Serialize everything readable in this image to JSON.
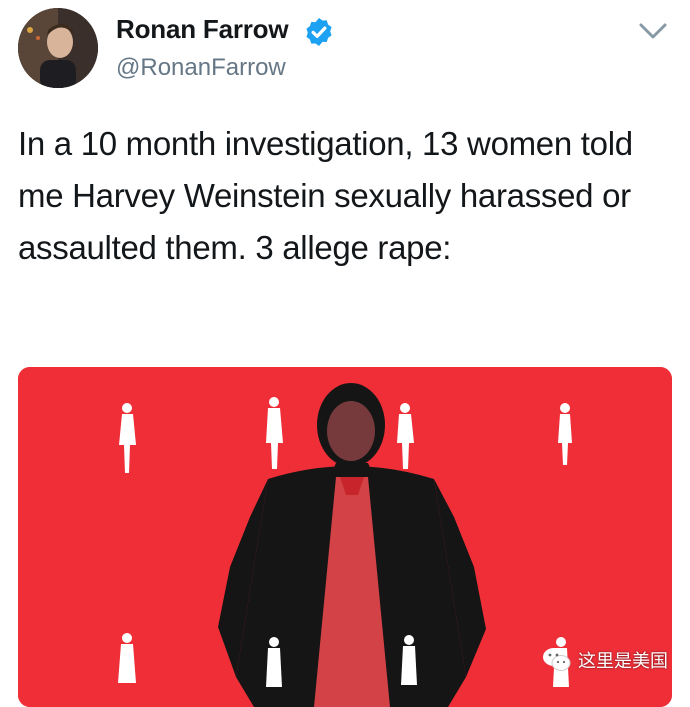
{
  "author": {
    "display_name": "Ronan Farrow",
    "handle": "@RonanFarrow",
    "verified": true,
    "avatar_icon": "profile-photo"
  },
  "tweet": {
    "text": "In a 10 month investigation, 13 women told me Harvey Weinstein sexually harassed or assaulted them. 3 allege rape:"
  },
  "menu": {
    "icon": "chevron-down-icon"
  },
  "media": {
    "background_color": "#ef2e37",
    "description_icon": "image"
  },
  "watermark": {
    "text": "这里是美国",
    "icon": "wechat-icon"
  },
  "colors": {
    "text": "#14171a",
    "secondary": "#657786",
    "verified": "#1da1f2",
    "media_red": "#ef2e37"
  }
}
